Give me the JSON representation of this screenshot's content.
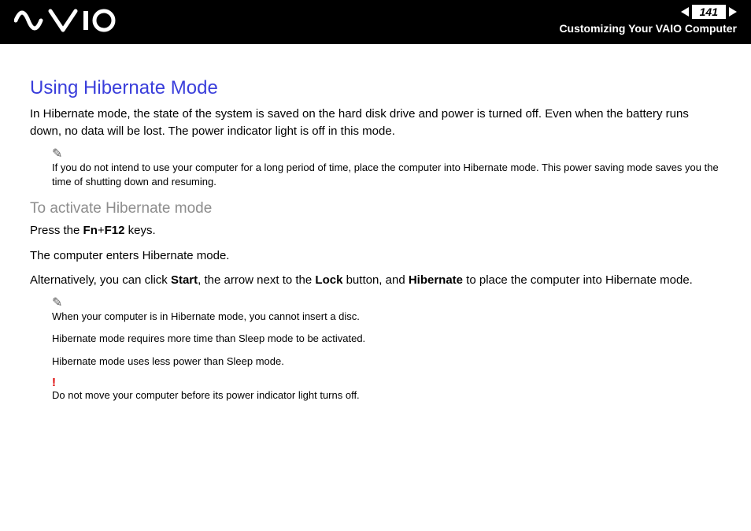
{
  "header": {
    "page_number": "141",
    "section": "Customizing Your VAIO Computer",
    "logo_alt": "VAIO"
  },
  "content": {
    "heading": "Using Hibernate Mode",
    "intro": "In Hibernate mode, the state of the system is saved on the hard disk drive and power is turned off. Even when the battery runs down, no data will be lost. The power indicator light is off in this mode.",
    "note1": "If you do not intend to use your computer for a long period of time, place the computer into Hibernate mode. This power saving mode saves you the time of shutting down and resuming.",
    "subhead": "To activate Hibernate mode",
    "press_line": {
      "prefix": "Press the ",
      "key1": "Fn",
      "plus": "+",
      "key2": "F12",
      "suffix": " keys."
    },
    "enters": "The computer enters Hibernate mode.",
    "alt_line": {
      "t1": "Alternatively, you can click ",
      "b1": "Start",
      "t2": ", the arrow next to the ",
      "b2": "Lock",
      "t3": " button, and ",
      "b3": "Hibernate",
      "t4": " to place the computer into Hibernate mode."
    },
    "note2a": "When your computer is in Hibernate mode, you cannot insert a disc.",
    "note2b": "Hibernate mode requires more time than Sleep mode to be activated.",
    "note2c": "Hibernate mode uses less power than Sleep mode.",
    "warning": "Do not move your computer before its power indicator light turns off."
  }
}
